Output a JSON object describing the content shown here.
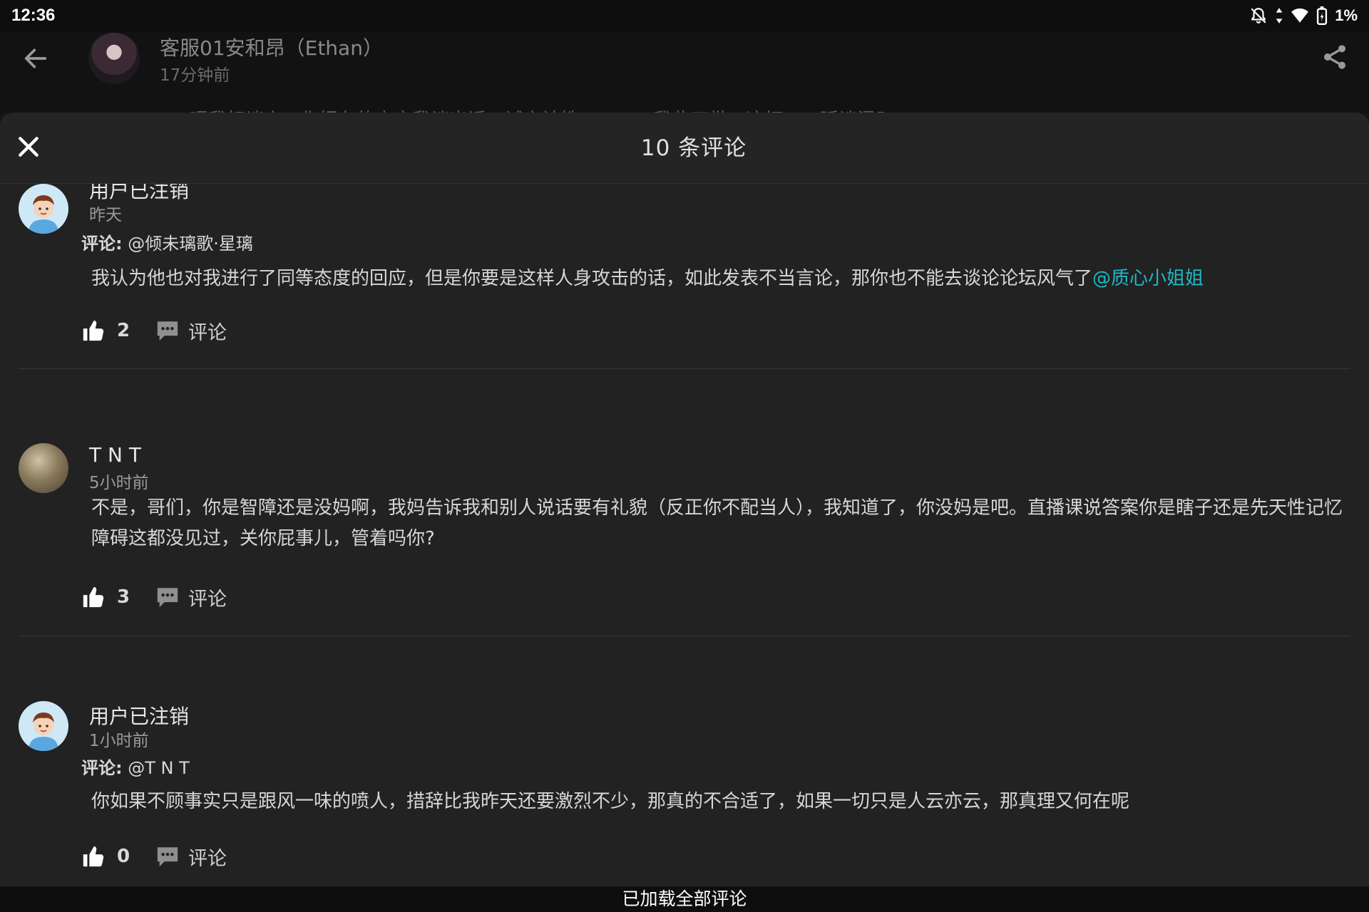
{
  "status_bar": {
    "time": "12:36",
    "battery": "1%",
    "icons": [
      "notifications-off-icon",
      "data-arrows-icon",
      "wifi-icon",
      "battery-charging-icon"
    ]
  },
  "post": {
    "author_name": "客服01安和昂（Ethan）",
    "time": "17分钟前",
    "peek_text": "…呢我标谈之，你把左的中方我谈出话，试之计性…………我此三带，这打……延谈混了…"
  },
  "sheet": {
    "title": "10 条评论"
  },
  "comments": [
    {
      "user": "用户已注销",
      "time": "昨天",
      "avatar": "cartoon-avatar",
      "reply_label": "评论:",
      "reply_target": "@倾未璃歌·星璃",
      "body": "我认为他也对我进行了同等态度的回应，但是你要是这样人身攻击的话，如此发表不当言论，那你也不能去谈论论坛风气了",
      "mention": "@质心小姐姐",
      "likes": "2",
      "reply_action": "评论"
    },
    {
      "user": "T N T",
      "time": "5小时前",
      "avatar": "sphere-avatar",
      "body": "不是，哥们，你是智障还是没妈啊，我妈告诉我和别人说话要有礼貌（反正你不配当人），我知道了，你没妈是吧。直播课说答案你是瞎子还是先天性记忆障碍这都没见过，关你屁事儿，管着吗你?",
      "likes": "3",
      "reply_action": "评论"
    },
    {
      "user": "用户已注销",
      "time": "1小时前",
      "avatar": "cartoon-avatar",
      "reply_label": "评论:",
      "reply_target": "@T N T",
      "body": "你如果不顾事实只是跟风一味的喷人，措辞比我昨天还要激烈不少，那真的不合适了，如果一切只是人云亦云，那真理又何在呢",
      "likes": "0",
      "reply_action": "评论"
    }
  ],
  "footer": {
    "text": "已加载全部评论"
  },
  "colors": {
    "mention": "#1fb8c6",
    "background": "#222222"
  }
}
